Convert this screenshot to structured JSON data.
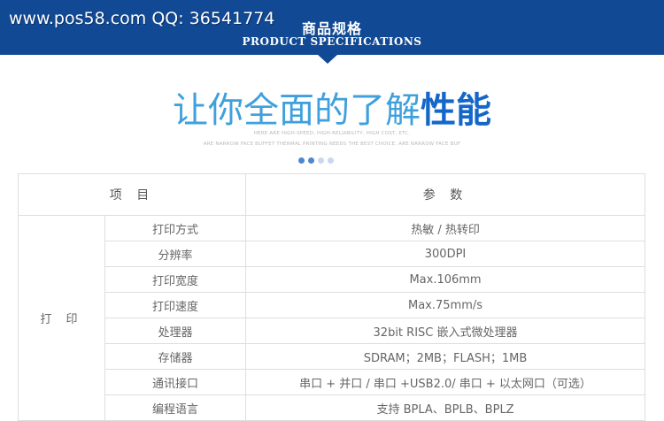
{
  "banner": {
    "watermark": "www.pos58.com QQ: 36541774",
    "title_cn": "商品规格",
    "title_en": "PRODUCT SPECIFICATIONS"
  },
  "headline": {
    "part1": "让你全面的了解",
    "part2": "性能",
    "sub1": "HERE ARE HIGH-SPEED, HIGH-RELIABILITY, HIGH COST, ETC.",
    "sub2": "ARE NARROW FACE BUFFET THERMAL PRINTING NEEDS THE BEST CHOICE, ARE NARROW FACE BUF"
  },
  "colors": {
    "banner": "#114994",
    "headline_light": "#3fa0dd",
    "headline_bold": "#1466c8"
  },
  "table": {
    "header_item": "项 目",
    "header_param": "参 数",
    "group": "打 印",
    "rows": [
      {
        "label": "打印方式",
        "value": "热敏 / 热转印"
      },
      {
        "label": "分辨率",
        "value": "300DPI"
      },
      {
        "label": "打印宽度",
        "value": "Max.106mm"
      },
      {
        "label": "打印速度",
        "value": "Max.75mm/s"
      },
      {
        "label": "处理器",
        "value": "32bit RISC 嵌入式微处理器"
      },
      {
        "label": "存储器",
        "value": "SDRAM；2MB；FLASH；1MB"
      },
      {
        "label": "通讯接口",
        "value": "串口 + 并口 / 串口 +USB2.0/ 串口 + 以太网口（可选）"
      },
      {
        "label": "编程语言",
        "value": "支持 BPLA、BPLB、BPLZ"
      }
    ]
  }
}
